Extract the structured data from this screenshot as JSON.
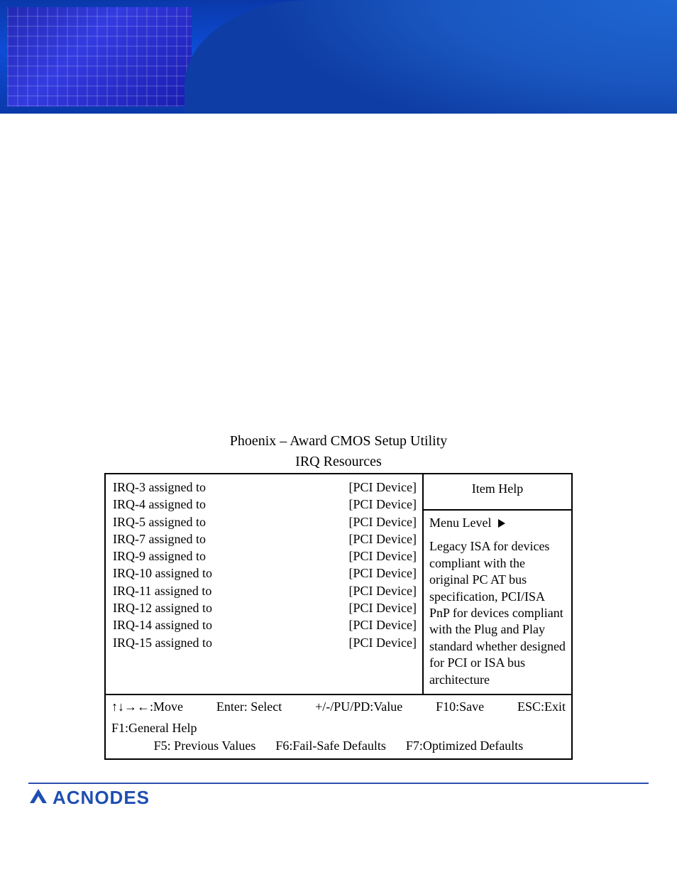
{
  "bios": {
    "heading_line1": "Phoenix – Award CMOS Setup Utility",
    "heading_line2": "IRQ Resources",
    "irq_rows": [
      {
        "label": "IRQ-3 assigned to",
        "value": "[PCI Device]"
      },
      {
        "label": "IRQ-4 assigned to",
        "value": "[PCI Device]"
      },
      {
        "label": "IRQ-5 assigned to",
        "value": "[PCI Device]"
      },
      {
        "label": "IRQ-7 assigned to",
        "value": "[PCI Device]"
      },
      {
        "label": "IRQ-9 assigned to",
        "value": "[PCI Device]"
      },
      {
        "label": "IRQ-10 assigned to",
        "value": "[PCI Device]"
      },
      {
        "label": "IRQ-11 assigned to",
        "value": "[PCI Device]"
      },
      {
        "label": "IRQ-12 assigned to",
        "value": "[PCI Device]"
      },
      {
        "label": "IRQ-14 assigned to",
        "value": "[PCI Device]"
      },
      {
        "label": "IRQ-15 assigned to",
        "value": "[PCI Device]"
      }
    ],
    "help": {
      "title": "Item Help",
      "menu_level_label": "Menu Level",
      "body": "Legacy ISA for devices compliant with the original PC AT bus specification, PCI/ISA PnP for devices compliant with the Plug and Play standard whether designed for PCI or ISA bus architecture"
    },
    "footer": {
      "row1": [
        "↑↓→←:Move",
        "Enter: Select",
        "+/-/PU/PD:Value",
        "F10:Save",
        "ESC:Exit",
        "F1:General Help"
      ],
      "row2": [
        "F5: Previous Values",
        "F6:Fail-Safe Defaults",
        "F7:Optimized Defaults"
      ]
    }
  },
  "brand": {
    "name": "ACNODES"
  }
}
